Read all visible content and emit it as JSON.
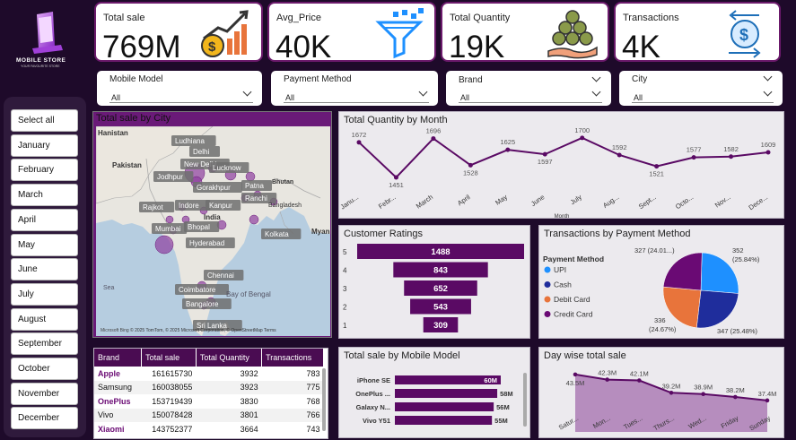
{
  "logo": {
    "line1": "MOBILE STORE",
    "line2": "YOUR FAVOURITE STORE"
  },
  "kpis": [
    {
      "label": "Total sale",
      "value": "769M",
      "icon": "money-growth-icon"
    },
    {
      "label": "Avg_Price",
      "value": "40K",
      "icon": "funnel-icon"
    },
    {
      "label": "Total Quantity",
      "value": "19K",
      "icon": "coins-hand-icon"
    },
    {
      "label": "Transactions",
      "value": "4K",
      "icon": "dollar-exchange-icon"
    }
  ],
  "slicers": [
    {
      "label": "Mobile Model",
      "value": "All"
    },
    {
      "label": "Payment Method",
      "value": "All"
    },
    {
      "label": "Brand",
      "value": "All"
    },
    {
      "label": "City",
      "value": "All"
    }
  ],
  "months": [
    "Select all",
    "January",
    "February",
    "March",
    "April",
    "May",
    "June",
    "July",
    "August",
    "September",
    "October",
    "November",
    "December"
  ],
  "map": {
    "title": "Total sale by City",
    "cities": [
      "Ludhiana",
      "Delhi",
      "New Delhi",
      "Jodhpur",
      "Lucknow",
      "Patna",
      "Gorakhpur",
      "Bhutan",
      "Rajkot",
      "Indore",
      "Kanpur",
      "Ranchi",
      "Bangladesh",
      "Mumbai",
      "Bhopal",
      "Kolkata",
      "Hyderabad",
      "Chennai",
      "Coimbatore",
      "Bangalore",
      "Pakistan",
      "India",
      "Bay of Bengal",
      "Sea",
      "Myan",
      "Hanistan",
      "Sri Lanka"
    ],
    "attribution": "© 2025 TomTom, © 2025 Microsoft Corporation, © OpenStreetMap  Terms",
    "ms_label": "Microsoft Bing"
  },
  "qty_month": {
    "title": "Total Quantity by Month",
    "xlabel": "Month"
  },
  "ratings": {
    "title": "Customer Ratings"
  },
  "payment": {
    "title": "Transactions by Payment Method",
    "legend_title": "Payment Method",
    "legend": [
      "UPI",
      "Cash",
      "Debit Card",
      "Credit Card"
    ],
    "labels": [
      "352 (25.84%)",
      "347 (25.48%)",
      "336 (24.67%)",
      "327 (24.01...)"
    ]
  },
  "model_sale": {
    "title": "Total sale by Mobile Model"
  },
  "daywise": {
    "title": "Day wise total sale"
  },
  "table": {
    "headers": [
      "Brand",
      "Total sale",
      "Total Quantity",
      "Transactions"
    ],
    "rows": [
      [
        "Apple",
        "161615730",
        "3932",
        "783"
      ],
      [
        "Samsung",
        "160038055",
        "3923",
        "775"
      ],
      [
        "OnePlus",
        "153719439",
        "3830",
        "768"
      ],
      [
        "Vivo",
        "150078428",
        "3801",
        "766"
      ],
      [
        "Xiaomi",
        "143752377",
        "3664",
        "743"
      ]
    ]
  },
  "chart_data": [
    {
      "type": "line",
      "title": "Total Quantity by Month",
      "xlabel": "Month",
      "categories": [
        "January",
        "February",
        "March",
        "April",
        "May",
        "June",
        "July",
        "August",
        "September",
        "October",
        "November",
        "December"
      ],
      "tick_labels": [
        "Janu...",
        "Febr...",
        "March",
        "April",
        "May",
        "June",
        "July",
        "Aug...",
        "Sept...",
        "Octo...",
        "Nov...",
        "Dece..."
      ],
      "values": [
        1672,
        1451,
        1696,
        1528,
        1625,
        1597,
        1700,
        1592,
        1521,
        1577,
        1582,
        1609
      ],
      "color": "#5a0a64"
    },
    {
      "type": "bar",
      "title": "Customer Ratings",
      "categories": [
        "5",
        "4",
        "3",
        "2",
        "1"
      ],
      "values": [
        1488,
        843,
        652,
        543,
        309
      ],
      "color": "#5a0a64"
    },
    {
      "type": "pie",
      "title": "Transactions by Payment Method",
      "categories": [
        "UPI",
        "Cash",
        "Debit Card",
        "Credit Card"
      ],
      "values": [
        352,
        347,
        336,
        327
      ],
      "percent": [
        25.84,
        25.48,
        24.67,
        24.01
      ],
      "colors": [
        "#1e90ff",
        "#1f2d9c",
        "#e8743b",
        "#6a0a74"
      ]
    },
    {
      "type": "bar",
      "title": "Total sale by Mobile Model",
      "categories": [
        "iPhone SE",
        "OnePlus ...",
        "Galaxy N...",
        "Vivo Y51"
      ],
      "values": [
        60,
        58,
        56,
        55
      ],
      "value_labels": [
        "60M",
        "58M",
        "56M",
        "55M"
      ],
      "color": "#5a0a64"
    },
    {
      "type": "area",
      "title": "Day wise total sale",
      "categories": [
        "Saturday",
        "Monday",
        "Tuesday",
        "Thursday",
        "Wednesday",
        "Friday",
        "Sunday"
      ],
      "tick_labels": [
        "Satur...",
        "Mon...",
        "Tues...",
        "Thurs...",
        "Wed...",
        "Friday",
        "Sunday"
      ],
      "values": [
        43.5,
        42.3,
        42.1,
        39.2,
        38.9,
        38.2,
        37.4
      ],
      "value_labels": [
        "43.5M",
        "42.3M",
        "42.1M",
        "39.2M",
        "38.9M",
        "38.2M",
        "37.4M"
      ],
      "color": "#7a2a85"
    }
  ]
}
